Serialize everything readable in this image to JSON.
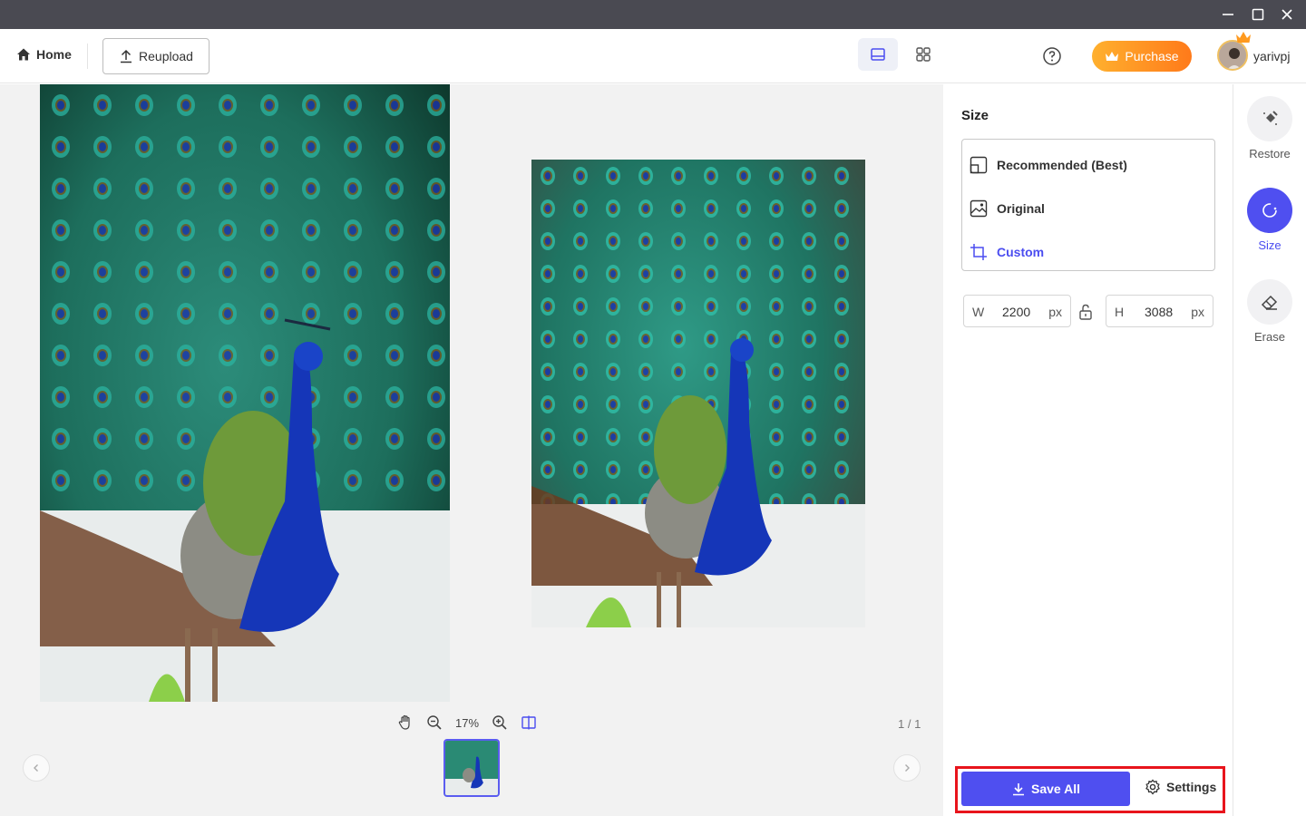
{
  "window": {
    "controls": [
      "minimize-icon",
      "maximize-icon",
      "close-icon"
    ]
  },
  "toolbar": {
    "home_label": "Home",
    "reupload_label": "Reupload",
    "purchase_label": "Purchase",
    "username": "yarivpj"
  },
  "viewer": {
    "zoom_percent": "17%",
    "page_count": "1 / 1"
  },
  "panel": {
    "title": "Size",
    "options": [
      {
        "label": "Recommended (Best)",
        "icon": "recommended-icon",
        "selected": false
      },
      {
        "label": "Original",
        "icon": "image-icon",
        "selected": false
      },
      {
        "label": "Custom",
        "icon": "crop-icon",
        "selected": true
      }
    ],
    "width": {
      "key": "W",
      "value": "2200",
      "unit": "px"
    },
    "height": {
      "key": "H",
      "value": "3088",
      "unit": "px"
    },
    "save_all_label": "Save All",
    "settings_label": "Settings"
  },
  "rail": {
    "tools": [
      {
        "label": "Restore",
        "icon": "restore-icon",
        "active": false
      },
      {
        "label": "Size",
        "icon": "size-icon",
        "active": true
      },
      {
        "label": "Erase",
        "icon": "eraser-icon",
        "active": false
      }
    ]
  },
  "colors": {
    "accent": "#4f4ff0",
    "purchase_start": "#ffb02e",
    "purchase_end": "#ff7a1a",
    "highlight": "#e8141c",
    "titlebar": "#4a4a52"
  }
}
